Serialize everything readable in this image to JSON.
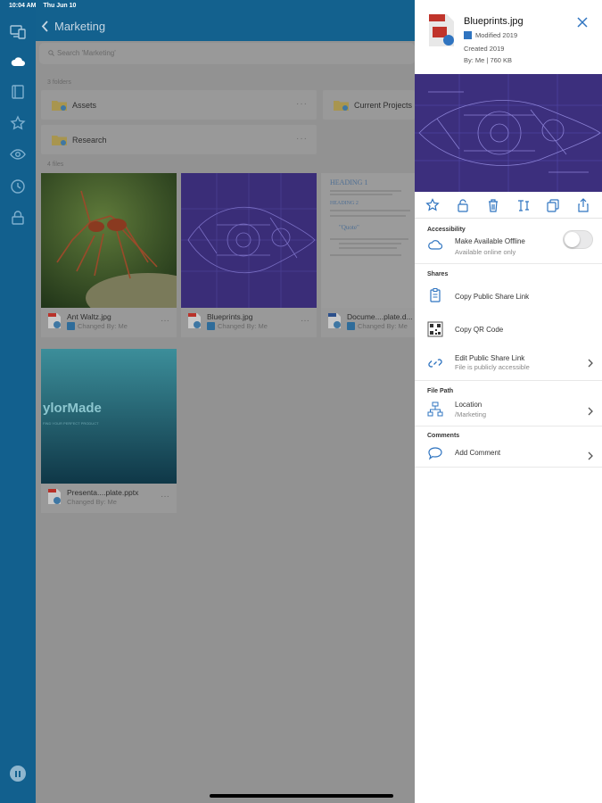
{
  "status": {
    "time": "10:04 AM",
    "date": "Thu Jun 10"
  },
  "nav": {
    "back_label": "Marketing"
  },
  "search": {
    "placeholder": "Search 'Marketing'"
  },
  "folders_header": "3 folders",
  "folders": [
    {
      "name": "Assets"
    },
    {
      "name": "Current Projects"
    },
    {
      "name": "Research"
    }
  ],
  "files_header": "4 files",
  "files": [
    {
      "name": "Ant Waltz.jpg",
      "sub": "Changed By: Me"
    },
    {
      "name": "Blueprints.jpg",
      "sub": "Changed By: Me"
    },
    {
      "name": "Docume....plate.d...",
      "sub": "Changed By: Me"
    },
    {
      "name": "Presenta....plate.pptx",
      "sub": "Changed By: Me"
    }
  ],
  "doc_thumb": {
    "heading": "HEADING 1",
    "subheading": "HEADING 2",
    "quote": "\"Quote\""
  },
  "ppt_thumb": {
    "title": "ylorMade",
    "subtitle": "FIND YOUR PERFECT PRODUCT"
  },
  "panel": {
    "title": "Blueprints.jpg",
    "modified": "Modified 2019",
    "created": "Created 2019",
    "by": "By: Me | 760 KB",
    "accessibility_header": "Accessibility",
    "offline_label": "Make Available Offline",
    "offline_sub": "Available online only",
    "offline_enabled": false,
    "shares_header": "Shares",
    "copy_link_label": "Copy Public Share Link",
    "qr_label": "Copy QR Code",
    "edit_link_label": "Edit Public Share Link",
    "edit_link_sub": "File is publicly accessible",
    "filepath_header": "File Path",
    "location_label": "Location",
    "location_value": "/Marketing",
    "comments_header": "Comments",
    "add_comment_label": "Add Comment"
  },
  "colors": {
    "sidebar": "#12608e",
    "accent": "#2f74c0",
    "panel_bg": "#ffffff"
  }
}
